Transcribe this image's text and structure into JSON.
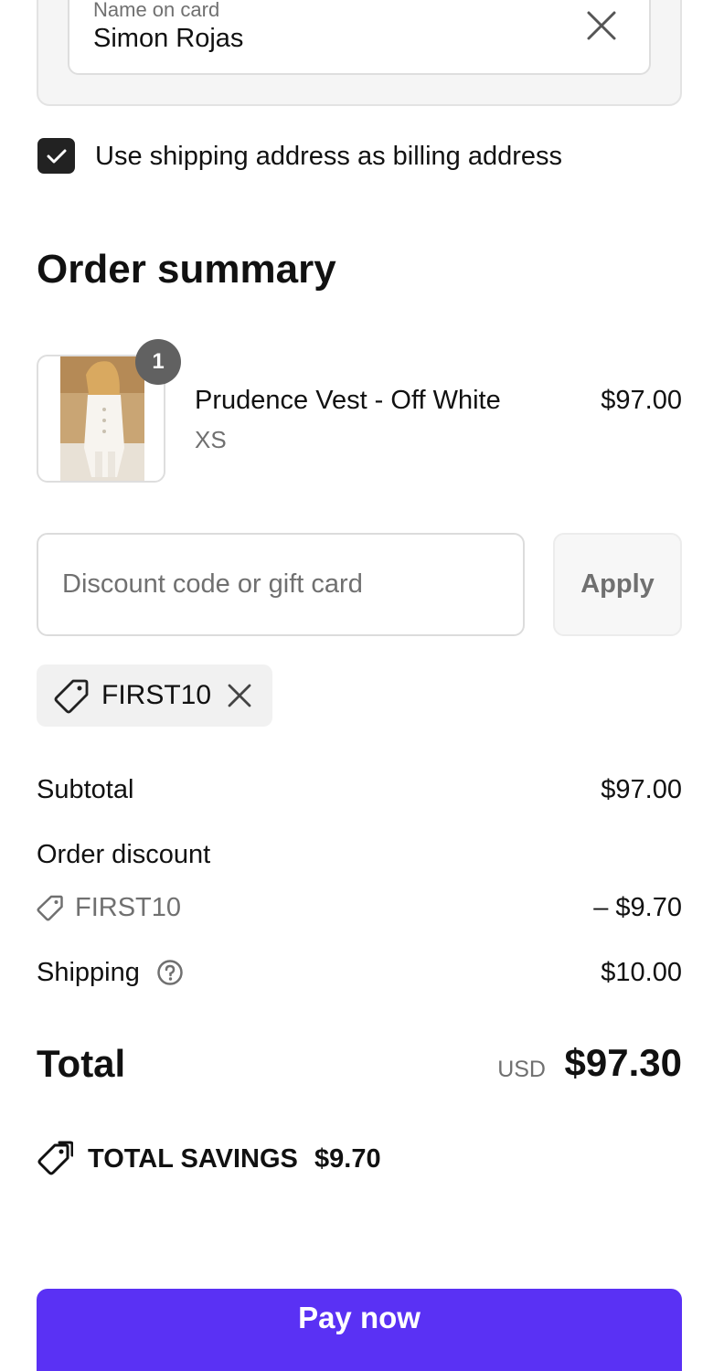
{
  "payment": {
    "name_label": "Name on card",
    "name_value": "Simon Rojas",
    "clear_icon": "close-icon"
  },
  "billing": {
    "checked": true,
    "label": "Use shipping address as billing address"
  },
  "summary": {
    "title": "Order summary",
    "item": {
      "quantity": "1",
      "name": "Prudence Vest - Off White",
      "variant": "XS",
      "price": "$97.00"
    },
    "discount": {
      "placeholder": "Discount code or gift card",
      "apply_label": "Apply",
      "applied_code": "FIRST10"
    },
    "rows": {
      "subtotal_label": "Subtotal",
      "subtotal_value": "$97.00",
      "discount_label": "Order discount",
      "discount_code": "FIRST10",
      "discount_value": "– $9.70",
      "shipping_label": "Shipping",
      "shipping_value": "$10.00"
    },
    "total": {
      "label": "Total",
      "currency": "USD",
      "value": "$97.30"
    },
    "savings": {
      "label": "TOTAL SAVINGS",
      "value": "$9.70"
    }
  },
  "pay_button_label": "Pay now",
  "colors": {
    "accent": "#5a31f4",
    "muted_text": "#707070",
    "badge": "#616161"
  }
}
